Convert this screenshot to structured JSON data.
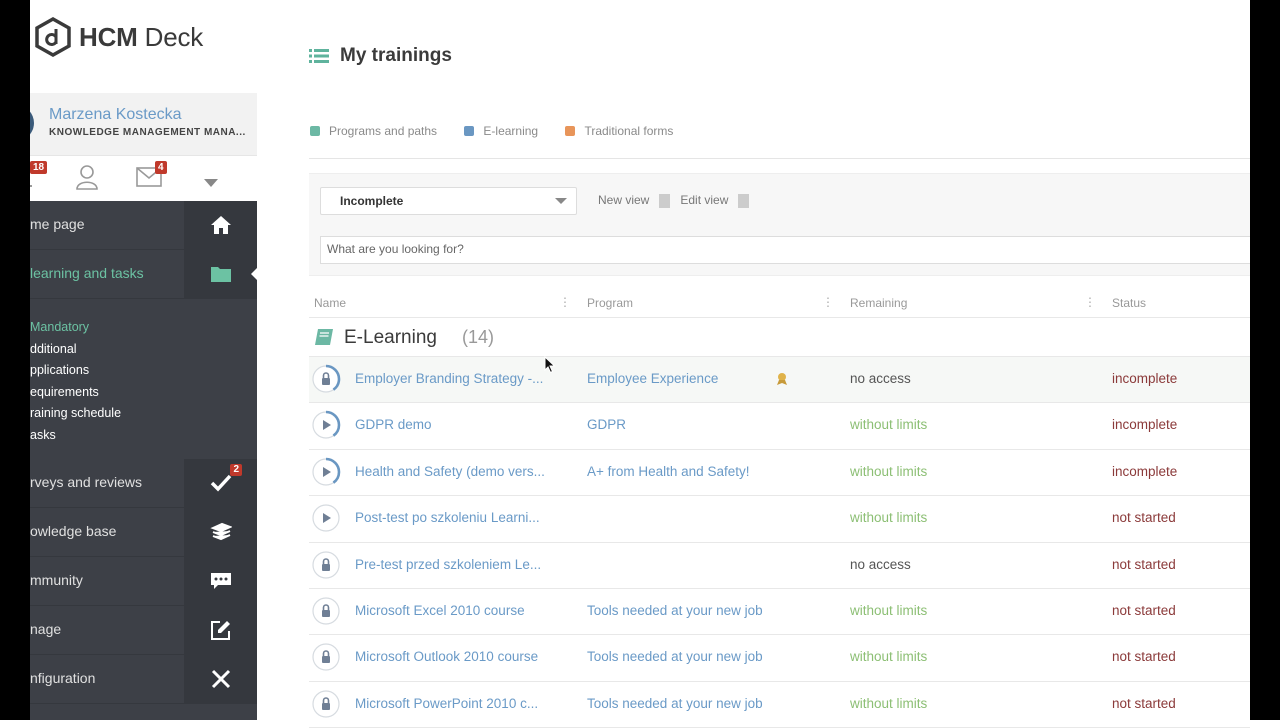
{
  "app": {
    "brand_bold": "HCM",
    "brand_light": " Deck"
  },
  "user": {
    "name": "Marzena Kostecka",
    "role": "KNOWLEDGE MANAGEMENT MANA..."
  },
  "header_icons": {
    "notifications_badge": "18",
    "messages_badge": "4"
  },
  "nav": {
    "items": [
      {
        "label": "me page",
        "icon": "home-icon"
      },
      {
        "label": "learning and tasks",
        "icon": "folder-icon",
        "active": true
      },
      {
        "label": "rveys and reviews",
        "icon": "check-icon",
        "badge": "2"
      },
      {
        "label": "owledge base",
        "icon": "books-icon"
      },
      {
        "label": "mmunity",
        "icon": "chat-icon"
      },
      {
        "label": "nage",
        "icon": "edit-icon"
      },
      {
        "label": "nfiguration",
        "icon": "tools-icon"
      }
    ],
    "subitems": [
      "Mandatory",
      "dditional",
      "pplications",
      "equirements",
      "raining schedule",
      "asks"
    ]
  },
  "page": {
    "title": "My trainings"
  },
  "legend": [
    {
      "label": "Programs and paths",
      "color": "#6cb8a4"
    },
    {
      "label": "E-learning",
      "color": "#6a97c2"
    },
    {
      "label": "Traditional forms",
      "color": "#e8955a"
    }
  ],
  "filter": {
    "selected_view": "Incomplete",
    "new_view": "New view",
    "edit_view": "Edit view",
    "search_placeholder": "What are you looking for?"
  },
  "table": {
    "columns": [
      "Name",
      "Program",
      "Remaining",
      "Status"
    ],
    "group": {
      "title": "E-Learning",
      "count": "(14)"
    },
    "rows": [
      {
        "name": "Employer Branding Strategy -...",
        "program": "Employee Experience",
        "remaining": "no access",
        "status": "incomplete",
        "icon": "lock",
        "progress": 0.4
      },
      {
        "name": "GDPR demo",
        "program": "GDPR",
        "remaining": "without limits",
        "status": "incomplete",
        "icon": "play",
        "progress": 0.4
      },
      {
        "name": "Health and Safety (demo vers...",
        "program": "A+ from Health and Safety!",
        "remaining": "without limits",
        "status": "incomplete",
        "icon": "play",
        "progress": 0.4
      },
      {
        "name": "Post-test po szkoleniu Learni...",
        "program": "",
        "remaining": "without limits",
        "status": "not started",
        "icon": "play",
        "progress": 0
      },
      {
        "name": "Pre-test przed szkoleniem Le...",
        "program": "",
        "remaining": "no access",
        "status": "not started",
        "icon": "lock",
        "progress": 0
      },
      {
        "name": "Microsoft Excel 2010 course",
        "program": "Tools needed at your new job",
        "remaining": "without limits",
        "status": "not started",
        "icon": "lock",
        "progress": 0
      },
      {
        "name": "Microsoft Outlook 2010 course",
        "program": "Tools needed at your new job",
        "remaining": "without limits",
        "status": "not started",
        "icon": "lock",
        "progress": 0
      },
      {
        "name": "Microsoft PowerPoint 2010 c...",
        "program": "Tools needed at your new job",
        "remaining": "without limits",
        "status": "not started",
        "icon": "lock",
        "progress": 0
      }
    ]
  }
}
